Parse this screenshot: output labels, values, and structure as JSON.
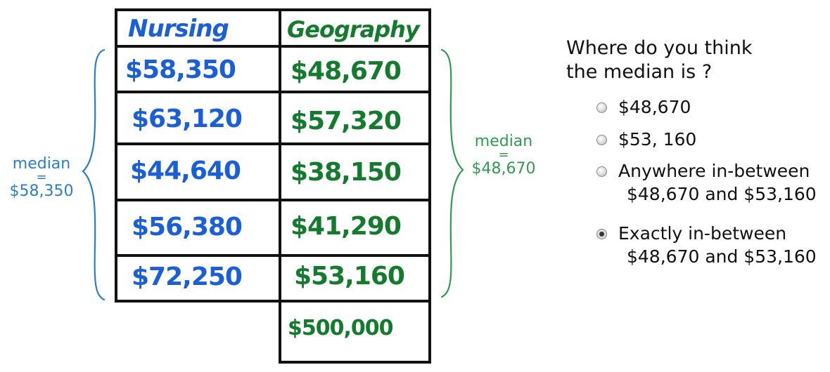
{
  "table": {
    "headers": {
      "nursing": "Nursing",
      "geography": "Geography"
    },
    "nursing": [
      "$58,350",
      "$63,120",
      "$44,640",
      "$56,380",
      "$72,250"
    ],
    "geography": [
      "$48,670",
      "$57,320",
      "$38,150",
      "$41,290",
      "$53,160",
      "$500,000"
    ]
  },
  "left_annotation": {
    "line1": "median",
    "line2": "=",
    "line3": "$58,350"
  },
  "right_annotation": {
    "line1": "median",
    "line2": "=",
    "line3": "$48,670"
  },
  "question": {
    "line1": "Where do you think",
    "line2": "the median is ?"
  },
  "options": [
    {
      "line1": "$48,670",
      "line2": "",
      "selected": false
    },
    {
      "line1": "$53, 160",
      "line2": "",
      "selected": false
    },
    {
      "line1": "Anywhere in-between",
      "line2": "$48,670 and $53,160",
      "selected": false
    },
    {
      "line1": "Exactly in-between",
      "line2": "$48,670 and $53,160",
      "selected": true
    }
  ],
  "colors": {
    "nursing": "#1a5fd6",
    "geography": "#137a2e",
    "annot_blue": "#2a7fc4",
    "annot_green": "#2f9a52"
  }
}
